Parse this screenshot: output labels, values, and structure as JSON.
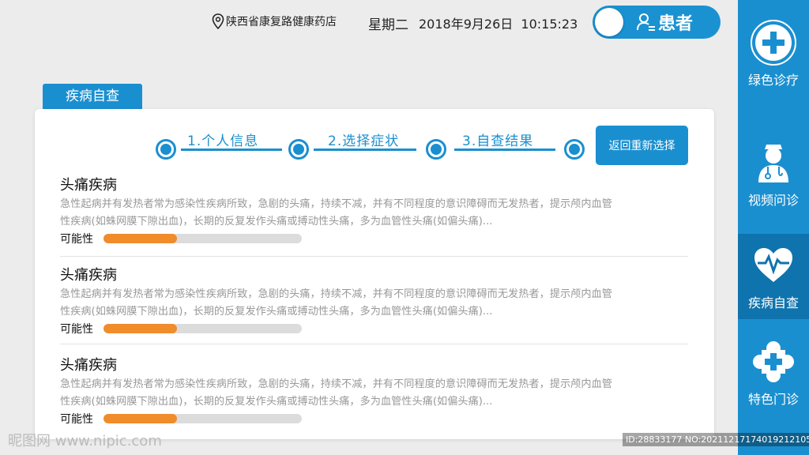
{
  "header": {
    "location": "陕西省康复路健康药店",
    "weekday": "星期二",
    "datetime": "2018年9月26日  10:15:23",
    "user_label": "患者"
  },
  "sidebar": {
    "items": [
      {
        "label": "绿色诊疗",
        "icon": "plus-circle-icon"
      },
      {
        "label": "视频问诊",
        "icon": "doctor-icon"
      },
      {
        "label": "疾病自查",
        "icon": "heartbeat-icon",
        "active": true
      },
      {
        "label": "特色门诊",
        "icon": "medical-cross-icon"
      }
    ]
  },
  "section": {
    "tab": "疾病自查",
    "steps": [
      "1.个人信息",
      "2.选择症状",
      "3.自查结果"
    ],
    "reset_button": "返回重新选择"
  },
  "results": [
    {
      "title": "头痛疾病",
      "desc_line1": "急性起病并有发热者常为感染性疾病所致，急剧的头痛，持续不减，并有不同程度的意识障碍而无发热者，提示颅内血管",
      "desc_line2": "性疾病(如蛛网膜下隙出血)，长期的反复发作头痛或搏动性头痛，多为血管性头痛(如偏头痛)...",
      "prob_label": "可能性",
      "probability": 0.37
    },
    {
      "title": "头痛疾病",
      "desc_line1": "急性起病并有发热者常为感染性疾病所致，急剧的头痛，持续不减，并有不同程度的意识障碍而无发热者，提示颅内血管",
      "desc_line2": "性疾病(如蛛网膜下隙出血)，长期的反复发作头痛或搏动性头痛，多为血管性头痛(如偏头痛)...",
      "prob_label": "可能性",
      "probability": 0.37
    },
    {
      "title": "头痛疾病",
      "desc_line1": "急性起病并有发热者常为感染性疾病所致，急剧的头痛，持续不减，并有不同程度的意识障碍而无发热者，提示颅内血管",
      "desc_line2": "性疾病(如蛛网膜下隙出血)，长期的反复发作头痛或搏动性头痛，多为血管性头痛(如偏头痛)...",
      "prob_label": "可能性",
      "probability": 0.37
    }
  ],
  "watermark": {
    "left": "昵图网 www.nipic.com",
    "right": "ID:28833177 NO:20211217174019212105"
  },
  "colors": {
    "primary": "#1a8fd0",
    "sidebar_active": "#0f73ad",
    "probability_fill": "#f08c2a"
  }
}
